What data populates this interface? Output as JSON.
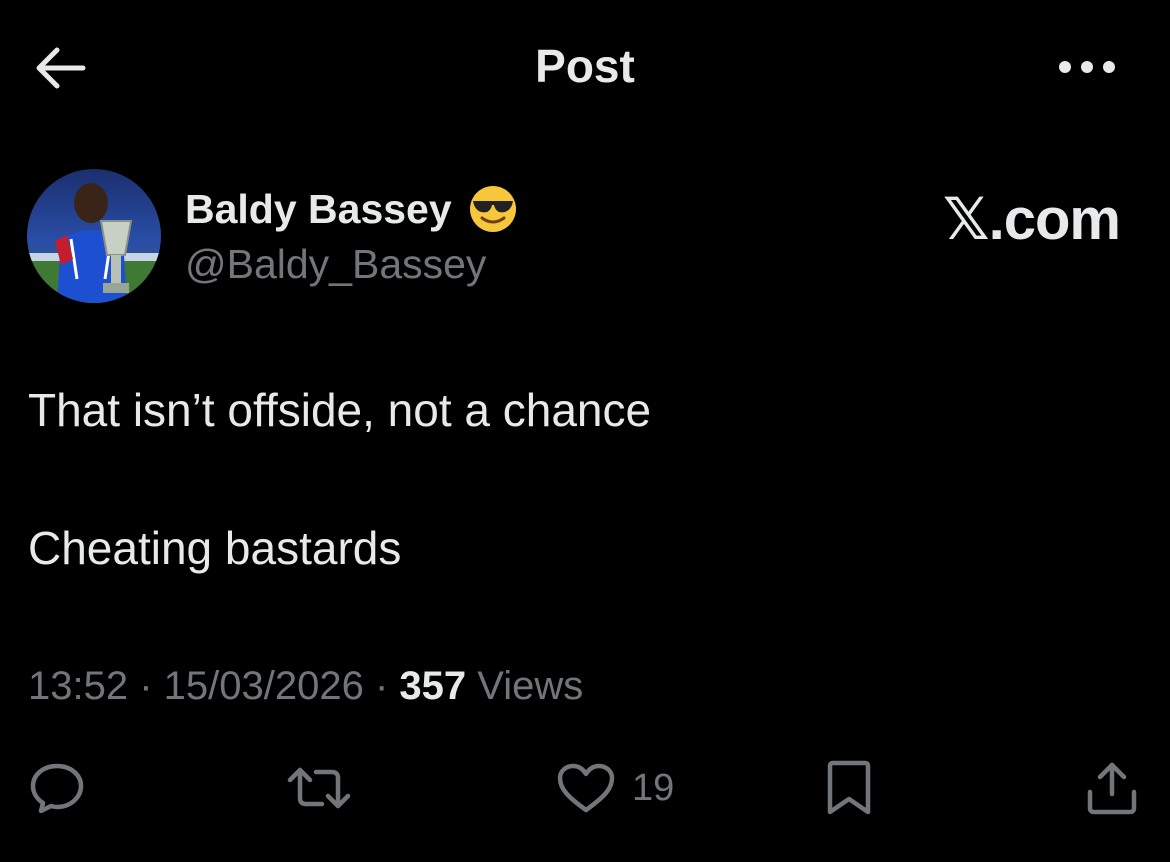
{
  "header": {
    "title": "Post",
    "back_icon": "arrow-left-icon",
    "more_icon": "more-horizontal-icon"
  },
  "author": {
    "display_name": "Baldy Bassey",
    "emoji_icon": "smiling-face-with-sunglasses-icon",
    "handle": "@Baldy_Bassey"
  },
  "watermark": "𝕏.com",
  "post": {
    "lines": [
      "That isn’t offside, not a chance",
      "Cheating bastards"
    ]
  },
  "meta": {
    "time": "13:52",
    "separator": " · ",
    "date": "15/03/2026",
    "views_count": "357",
    "views_label": " Views"
  },
  "actions": {
    "reply_icon": "reply-icon",
    "repost_icon": "repost-icon",
    "like_icon": "heart-icon",
    "like_count": "19",
    "bookmark_icon": "bookmark-icon",
    "share_icon": "share-icon"
  },
  "colors": {
    "background": "#000000",
    "primary_text": "#e7e9ea",
    "secondary_text": "#71767b"
  }
}
